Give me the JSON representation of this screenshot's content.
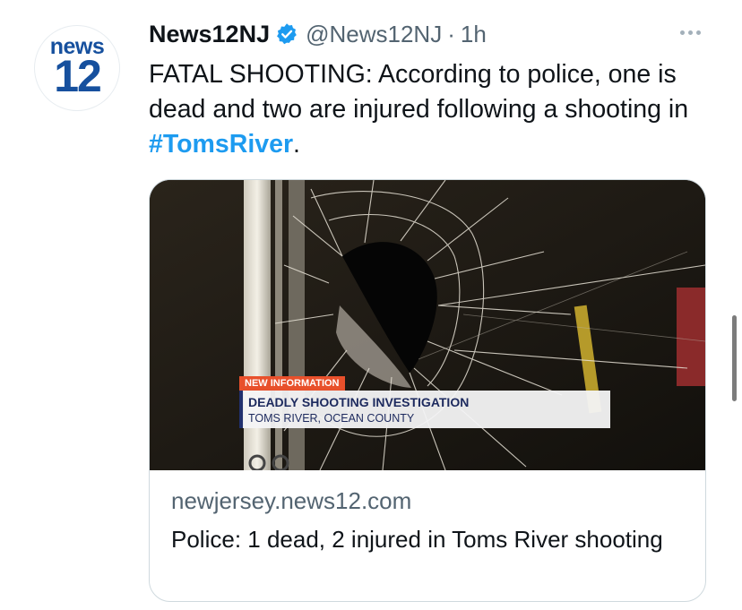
{
  "author": {
    "avatar_text_top": "news",
    "avatar_text_num": "12",
    "display_name": "News12NJ",
    "handle": "@News12NJ",
    "separator": "·",
    "time": "1h",
    "verified": true,
    "avatar_icon": "news12-logo-icon",
    "verified_icon": "verified-badge-icon"
  },
  "tweet": {
    "text_prefix": "FATAL SHOOTING: According to police, one is dead and two are injured following a shooting in ",
    "hashtag": "#TomsRiver",
    "text_suffix": "."
  },
  "card": {
    "image_icon": "broken-glass-photo",
    "lower_third": {
      "tag": "NEW INFORMATION",
      "headline": "DEADLY SHOOTING INVESTIGATION",
      "location": "TOMS RIVER, OCEAN COUNTY"
    },
    "domain": "newjersey.news12.com",
    "title": "Police: 1 dead, 2 injured in Toms River shooting"
  },
  "actions": {
    "more_icon": "more-options-icon"
  },
  "colors": {
    "accent": "#1d9bf0",
    "text": "#0f1419",
    "muted": "#536471",
    "brand": "#16509e",
    "lower_third_tag": "#e8502b"
  }
}
